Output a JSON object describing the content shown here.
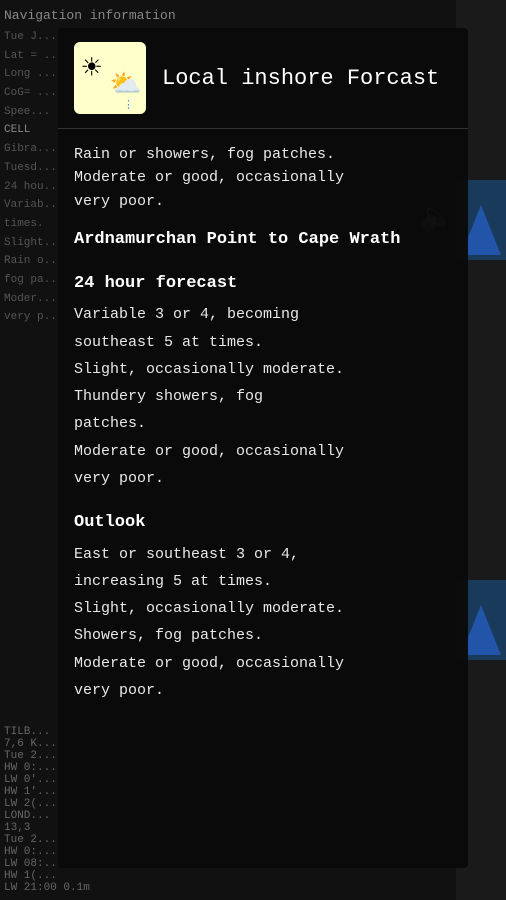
{
  "background": {
    "nav_label": "Navigation information",
    "lines": [
      "Tue J...",
      "Lat = ...",
      "Long ...",
      "CoG= ...",
      "Spee...",
      "CELL",
      "Gibra...",
      "Tuesd...",
      "24 hou...",
      "Variab...",
      "times.",
      "Slight...",
      "Rain o...",
      "fog pa...",
      "Moder...",
      "very p..."
    ],
    "bottom_text": "LW 21:00 0.1m"
  },
  "modal": {
    "title": "Local inshore Forcast",
    "icon_alt": "sunny with cloud and rain",
    "intro": {
      "line1": "Rain or showers, fog patches.",
      "line2": "Moderate or good, occasionally",
      "line3": "very poor."
    },
    "location": "Ardnamurchan Point to Cape Wrath",
    "forecast_heading": "24 hour forecast",
    "forecast_lines": [
      "Variable 3 or 4, becoming",
      "southeast 5 at times.",
      "Slight, occasionally moderate.",
      "Thundery showers, fog",
      "patches.",
      "Moderate or good, occasionally",
      "very poor."
    ],
    "outlook_heading": "Outlook",
    "outlook_lines": [
      "East or southeast 3 or 4,",
      "increasing 5 at times.",
      "Slight, occasionally moderate.",
      "Showers, fog patches.",
      "Moderate or good, occasionally",
      "very poor."
    ]
  }
}
